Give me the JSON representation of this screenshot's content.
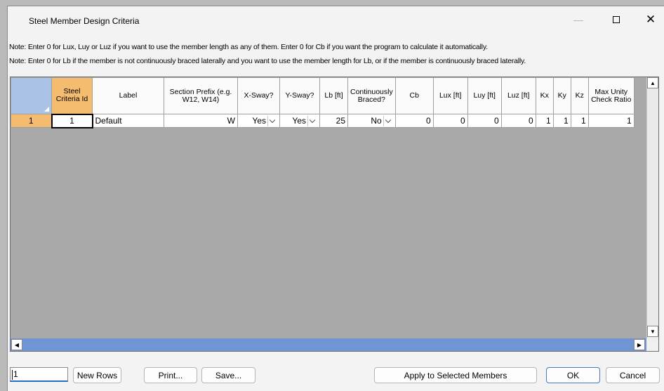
{
  "window": {
    "title": "Steel Member Design Criteria"
  },
  "notes": [
    "Note: Enter 0 for Lux, Luy or Luz if you want to use the member length as any of them.  Enter 0 for Cb if you want the program to calculate it automatically.",
    "Note: Enter 0 for Lb if the member is not continuously braced laterally and  you want to use the member length for Lb, or if the member is continuously braced laterally."
  ],
  "table": {
    "headers": [
      "Steel Criteria Id",
      "Label",
      "Section Prefix (e.g. W12, W14)",
      "X-Sway?",
      "Y-Sway?",
      "Lb [ft]",
      "Continuously Braced?",
      "Cb",
      "Lux [ft]",
      "Luy [ft]",
      "Luz [ft]",
      "Kx",
      "Ky",
      "Kz",
      "Max Unity Check Ratio"
    ],
    "rows": [
      {
        "row_number": "1",
        "steel_criteria_id": "1",
        "label": "Default",
        "section_prefix": "W",
        "x_sway": "Yes",
        "y_sway": "Yes",
        "lb": "25",
        "continuously_braced": "No",
        "cb": "0",
        "lux": "0",
        "luy": "0",
        "luz": "0",
        "kx": "1",
        "ky": "1",
        "kz": "1",
        "max_unity_check_ratio": "1"
      }
    ]
  },
  "footer": {
    "rows_count_value": "1",
    "new_rows": "New Rows",
    "print": "Print...",
    "save": "Save...",
    "apply": "Apply to Selected Members",
    "ok": "OK",
    "cancel": "Cancel"
  }
}
